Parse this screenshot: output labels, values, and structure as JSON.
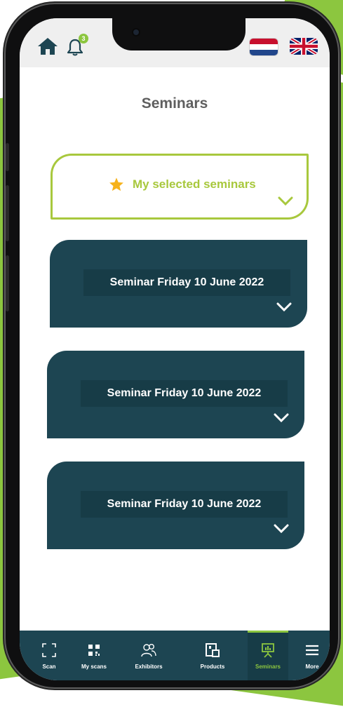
{
  "header": {
    "notification_count": "3",
    "languages": [
      "Nederlands",
      "English"
    ]
  },
  "page": {
    "title": "Seminars"
  },
  "selected_seminars": {
    "label": "My selected seminars"
  },
  "seminars": [
    {
      "label": "Seminar Friday 10 June 2022"
    },
    {
      "label": "Seminar Friday 10 June 2022"
    },
    {
      "label": "Seminar Friday 10 June 2022"
    }
  ],
  "bottom_nav": {
    "items": [
      {
        "label": "Scan",
        "icon": "scan-icon",
        "active": false
      },
      {
        "label": "My scans",
        "icon": "qr-code-icon",
        "active": false
      },
      {
        "label": "Exhibitors",
        "icon": "users-icon",
        "active": false
      },
      {
        "label": "Products",
        "icon": "product-icon",
        "active": false
      },
      {
        "label": "Seminars",
        "icon": "presentation-icon",
        "active": true
      },
      {
        "label": "More",
        "icon": "menu-icon",
        "active": false
      }
    ]
  },
  "colors": {
    "brand_green": "#8cc63f",
    "accent_lime": "#a8c83d",
    "dark_teal": "#1d4552",
    "star": "#f6b21b",
    "title_gray": "#5f5f5f"
  }
}
